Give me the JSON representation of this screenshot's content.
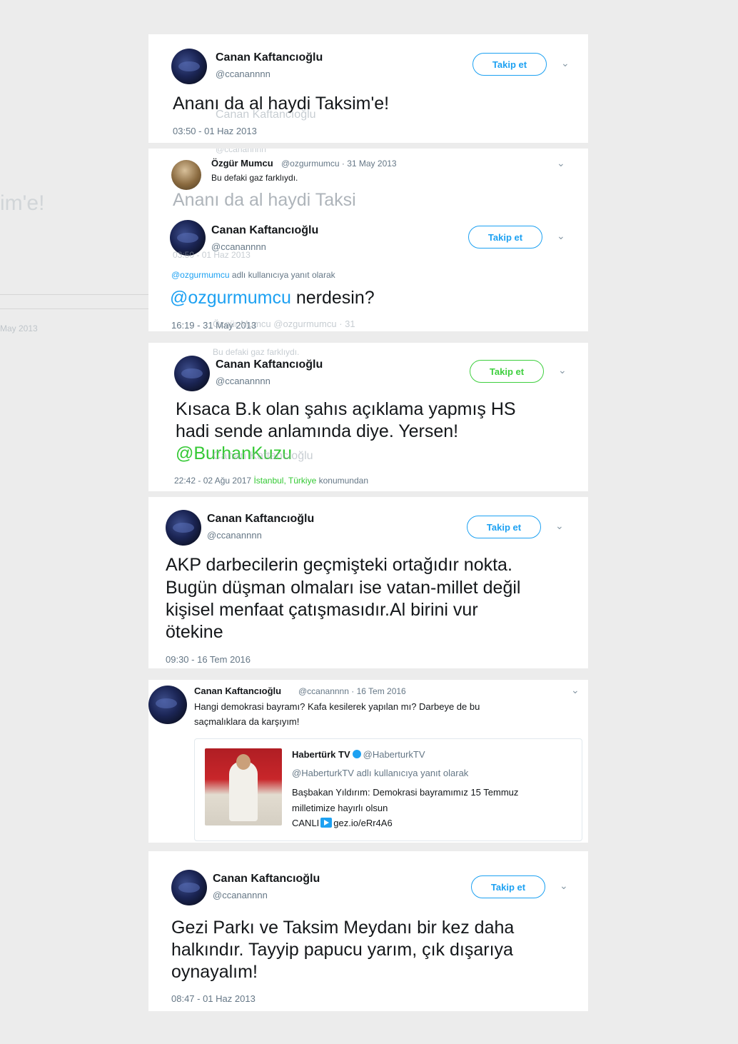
{
  "follow_label": "Takip et",
  "chevron": "⌄",
  "left_ghost": {
    "text1": "im'e!",
    "text2": "May 2013"
  },
  "tweet1": {
    "name": "Canan Kaftancıoğlu",
    "handle": "@ccanannnn",
    "text": "Ananı da al haydi Taksim'e!",
    "time": "03:50 - 01 Haz 2013",
    "ghost_name": "Canan Kaftancıoğlu",
    "ghost_handle": "@ccanannnn"
  },
  "tweet2": {
    "name": "Özgür Mumcu",
    "handle_date": "@ozgurmumcu · 31 May 2013",
    "text": "Bu defaki gaz farklıydı.",
    "ghost_text": "Ananı da al haydi Taksi"
  },
  "tweet3": {
    "name": "Canan Kaftancıoğlu",
    "handle": "@ccanannnn",
    "ghost_time": "03:50 - 01 Haz 2013",
    "reply_to_handle": "@ozgurmumcu",
    "reply_to_rest": "adlı kullanıcıya yanıt olarak",
    "mention": "@ozgurmumcu",
    "text": "nerdesin?",
    "time": "16:19 - 31 May 2013",
    "ghost_name": "Özgür Mumcu @ozgurmumcu · 31",
    "ghost_text": "Bu defaki gaz farklıydı."
  },
  "tweet4": {
    "name": "Canan Kaftancıoğlu",
    "handle": "@ccanannnn",
    "text_line1": "Kısaca B.k olan şahıs açıklama yapmış HS",
    "text_line2": "hadi sende anlamında diye. Yersen!",
    "mention": "@BurhanKuzu",
    "ghost_name": "Canan Kaftancıoğlu",
    "ghost_handle": "@ccanannnn",
    "time": "22:42 - 02 Ağu 2017",
    "location": "İstanbul, Türkiye",
    "location_suffix": "konumundan"
  },
  "tweet5": {
    "name": "Canan Kaftancıoğlu",
    "handle": "@ccanannnn",
    "text_line1": "AKP darbecilerin geçmişteki ortağıdır nokta.",
    "text_line2": "Bugün düşman olmaları ise vatan-millet değil",
    "text_line3": "kişisel menfaat çatışmasıdır.Al birini vur",
    "text_line4": "ötekine",
    "time": "09:30 - 16 Tem 2016"
  },
  "tweet6": {
    "name": "Canan Kaftancıoğlu",
    "handle_date": "@ccanannnn · 16 Tem 2016",
    "text_line1": "Hangi demokrasi bayramı? Kafa kesilerek yapılan mı? Darbeye de bu",
    "text_line2": "saçmalıklara da karşıyım!",
    "quote": {
      "name": "Habertürk TV",
      "handle": "@HaberturkTV",
      "reply_line": "@HaberturkTV adlı kullanıcıya yanıt olarak",
      "text_line1": "Başbakan Yıldırım: Demokrasi bayramımız 15 Temmuz",
      "text_line2": "milletimize hayırlı olsun",
      "canli": "CANLI",
      "link": "gez.io/eRr4A6"
    }
  },
  "tweet7": {
    "name": "Canan Kaftancıoğlu",
    "handle": "@ccanannnn",
    "text_line1": "Gezi Parkı ve Taksim Meydanı bir kez daha",
    "text_line2": "halkındır. Tayyip papucu yarım, çık dışarıya",
    "text_line3": "oynayalım!",
    "time": "08:47 - 01 Haz 2013"
  }
}
